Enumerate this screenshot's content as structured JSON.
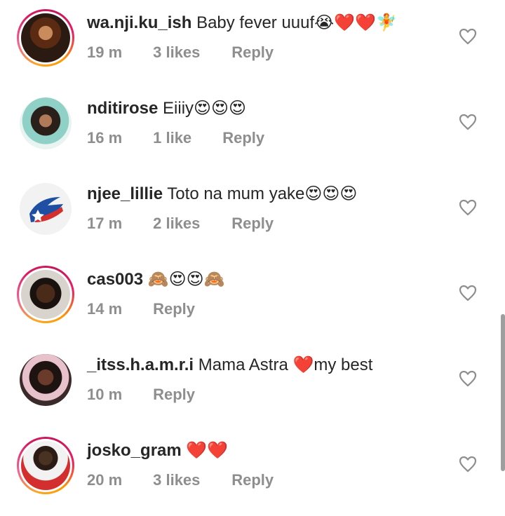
{
  "comments": [
    {
      "username": "wa.nji.ku_ish",
      "text": "Baby fever uuuf😭❤️❤️🧚",
      "time": "19 m",
      "likes": "3 likes",
      "reply": "Reply",
      "has_story_ring": true,
      "avatar_icon": "user-avatar-icon"
    },
    {
      "username": "nditirose",
      "text": "Eiiiy😍😍😍",
      "time": "16 m",
      "likes": "1 like",
      "reply": "Reply",
      "has_story_ring": false,
      "avatar_icon": "user-avatar-icon"
    },
    {
      "username": "njee_lillie",
      "text": "Toto na mum yake😍😍😍",
      "time": "17 m",
      "likes": "2 likes",
      "reply": "Reply",
      "has_story_ring": false,
      "avatar_icon": "flag-logo-avatar-icon"
    },
    {
      "username": "cas003",
      "text": "🙈😍😍🙈",
      "time": "14 m",
      "likes": "",
      "reply": "Reply",
      "has_story_ring": true,
      "avatar_icon": "user-avatar-icon"
    },
    {
      "username": "_itss.h.a.m.r.i",
      "text": "Mama Astra ❤️my best",
      "time": "10 m",
      "likes": "",
      "reply": "Reply",
      "has_story_ring": false,
      "avatar_icon": "user-avatar-icon"
    },
    {
      "username": "josko_gram",
      "text": "❤️❤️",
      "time": "20 m",
      "likes": "3 likes",
      "reply": "Reply",
      "has_story_ring": true,
      "avatar_icon": "user-avatar-icon"
    }
  ],
  "colors": {
    "text": "#262626",
    "meta": "#8e8e8e",
    "heart_outline": "#8e8e8e",
    "scrollbar": "#9e9e9e"
  }
}
